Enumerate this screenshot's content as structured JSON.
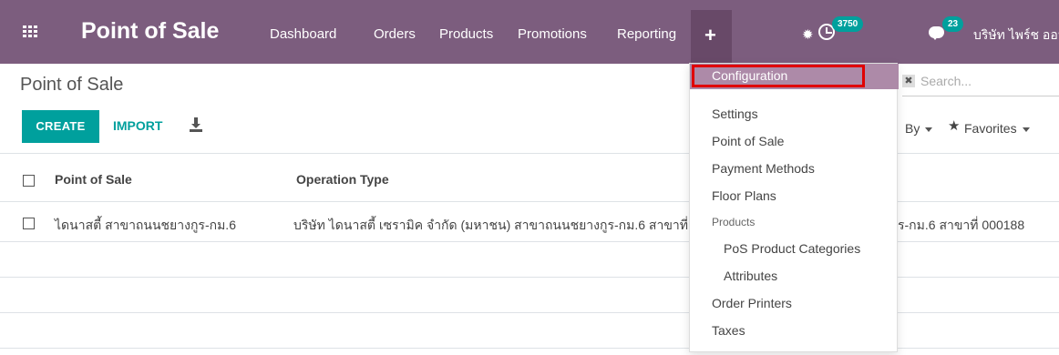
{
  "navbar": {
    "app_name": "Point of Sale",
    "menus": [
      "Dashboard",
      "Orders",
      "Products",
      "Promotions",
      "Reporting"
    ],
    "plus_label": "+",
    "activity_count": "3750",
    "message_count": "23",
    "company": "บริษัท ไพร์ช ออฟ",
    "icons": [
      "apps-icon",
      "plus-icon",
      "bug-icon",
      "clock-icon",
      "chat-icon"
    ]
  },
  "control_panel": {
    "breadcrumb": "Point of Sale",
    "create_label": "CREATE",
    "import_label": "IMPORT",
    "download_icon": "download-icon",
    "search_placeholder": "Search...",
    "group_by_label": "By",
    "favorites_label": "Favorites"
  },
  "list": {
    "columns": [
      "Point of Sale",
      "Operation Type"
    ],
    "rows": [
      {
        "point_of_sale": "ไดนาสตี้ สาขาถนนชยางกูร-กม.6",
        "operation_type": "บริษัท ไดนาสตี้ เซรามิค จำกัด (มหาชน) สาขาถนนชยางกูร-กม.6 สาขาที่ 000188",
        "trailing_visible": "ร-กม.6 สาขาที่ 000188"
      }
    ]
  },
  "dropdown": {
    "active_item": "Configuration",
    "items": {
      "settings": "Settings",
      "point_of_sale": "Point of Sale",
      "payment_methods": "Payment Methods",
      "floor_plans": "Floor Plans",
      "products_header": "Products",
      "pos_product_categories": "PoS Product Categories",
      "attributes": "Attributes",
      "order_printers": "Order Printers",
      "taxes": "Taxes"
    }
  },
  "colors": {
    "navbar_bg": "#7c5d7e",
    "accent_teal": "#00a09d",
    "highlight_red": "#e00000",
    "active_menu_bg": "#ad8aa8"
  }
}
